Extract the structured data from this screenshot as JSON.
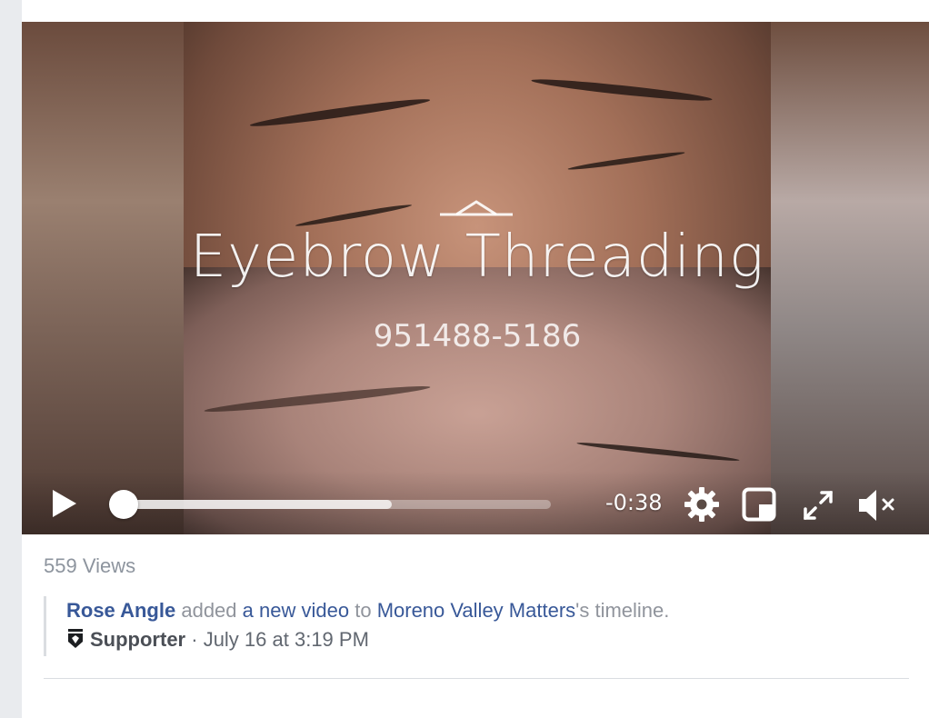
{
  "video": {
    "overlay_title": "Eyebrow Threading",
    "overlay_phone": "951488-5186",
    "time_remaining": "-0:38",
    "progress_played": 0.0,
    "progress_buffered": 0.63
  },
  "post": {
    "views_label": "559 Views",
    "author_name": "Rose Angle",
    "action_text": "added",
    "action_link": "a new video",
    "to_text": "to",
    "page_name": "Moreno Valley Matters",
    "suffix_text": "'s timeline.",
    "badge_label": "Supporter",
    "separator": " · ",
    "timestamp": "July 16 at 3:19 PM"
  },
  "icons": {
    "play": "play-icon",
    "settings": "gear-icon",
    "pip": "picture-in-picture-icon",
    "fullscreen": "expand-icon",
    "mute": "muted-speaker-icon",
    "supporter": "shield-badge-icon"
  },
  "colors": {
    "link": "#385898",
    "muted_text": "#90949c",
    "gutter": "#e9ebee"
  }
}
